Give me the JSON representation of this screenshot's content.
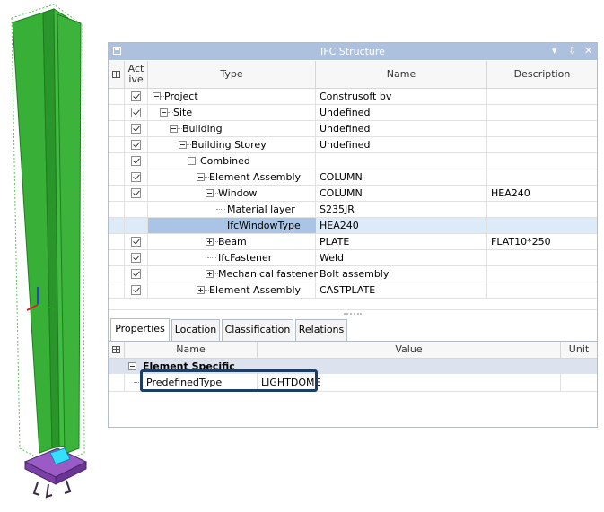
{
  "window": {
    "title": "IFC Structure",
    "pin_glyph": "▾",
    "dock_glyph": "⇩",
    "close_glyph": "✕"
  },
  "columns": {
    "active": "Active",
    "type": "Type",
    "name": "Name",
    "description": "Description"
  },
  "rows": [
    {
      "checked": true,
      "type": "Project",
      "name": "Construsoft bv",
      "description": ""
    },
    {
      "checked": true,
      "type": "Site",
      "name": "Undefined",
      "description": ""
    },
    {
      "checked": true,
      "type": "Building",
      "name": "Undefined",
      "description": ""
    },
    {
      "checked": true,
      "type": "Building Storey",
      "name": "Undefined",
      "description": ""
    },
    {
      "checked": true,
      "type": "Combined",
      "name": "",
      "description": ""
    },
    {
      "checked": true,
      "type": "Element Assembly",
      "name": "COLUMN",
      "description": ""
    },
    {
      "checked": true,
      "type": "Window",
      "name": "COLUMN",
      "description": "HEA240"
    },
    {
      "checked": false,
      "type": "Material layer",
      "name": "S235JR",
      "description": ""
    },
    {
      "checked": false,
      "type": "IfcWindowType",
      "name": "HEA240",
      "description": "",
      "selected": true
    },
    {
      "checked": true,
      "type": "Beam",
      "name": "PLATE",
      "description": "FLAT10*250"
    },
    {
      "checked": true,
      "type": "IfcFastener",
      "name": "Weld",
      "description": ""
    },
    {
      "checked": true,
      "type": "Mechanical fastener",
      "name": "Bolt assembly",
      "description": ""
    },
    {
      "checked": true,
      "type": "Element Assembly",
      "name": "CASTPLATE",
      "description": ""
    }
  ],
  "tabs": [
    "Properties",
    "Location",
    "Classification",
    "Relations"
  ],
  "properties": {
    "columns": {
      "name": "Name",
      "value": "Value",
      "unit": "Unit"
    },
    "group": "Element Specific",
    "rows": [
      {
        "name": "PredefinedType",
        "value": "LIGHTDOME",
        "unit": ""
      }
    ]
  },
  "colors": {
    "model_green": "#3cb43c",
    "title_bar": "#adc1de",
    "selection": "#a9c4e4",
    "highlight_border": "#1b3d66"
  }
}
